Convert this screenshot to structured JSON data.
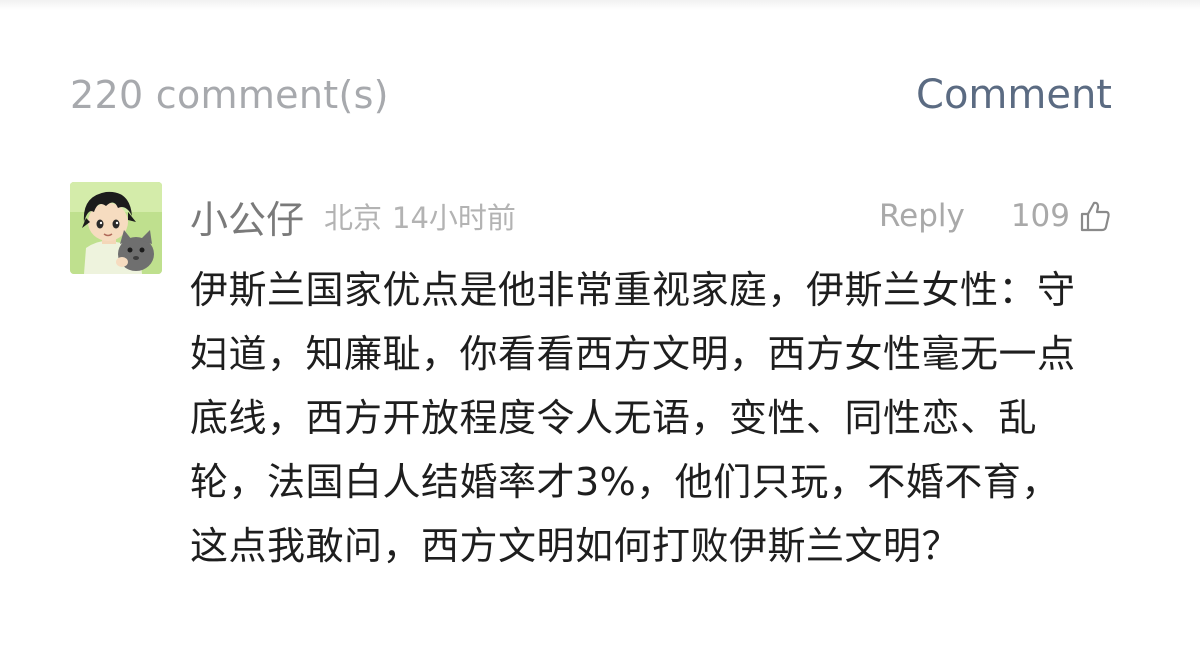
{
  "header": {
    "comment_count": "220 comment(s)",
    "comment_button": "Comment"
  },
  "comment": {
    "username": "小公仔",
    "location": "北京",
    "time": "14小时前",
    "reply_label": "Reply",
    "likes": "109",
    "avatar_icon": "cartoon-boy-with-cat-avatar",
    "like_icon": "thumbs-up-icon",
    "text": "伊斯兰国家优点是他非常重视家庭，伊斯兰女性：守妇道，知廉耻，你看看西方文明，西方女性毫无一点底线，西方开放程度令人无语，变性、同性恋、乱轮，法国白人结婚率才3%，他们只玩，不婚不育，这点我敢问，西方文明如何打败伊斯兰文明？"
  },
  "colors": {
    "count_gray": "#a7a9ad",
    "comment_button_blue": "#5b6b82",
    "meta_gray": "#b3b3b3",
    "body_text": "#1e1e1e"
  }
}
